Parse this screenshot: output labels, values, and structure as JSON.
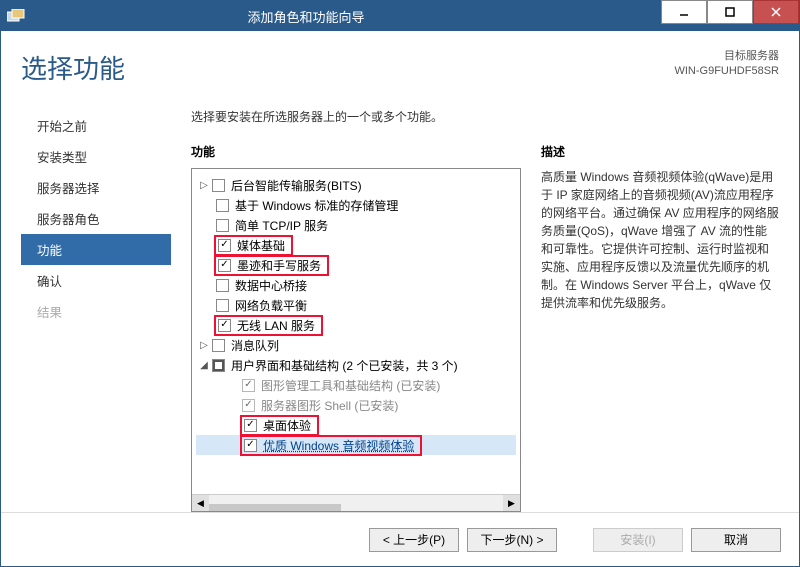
{
  "window": {
    "title": "添加角色和功能向导"
  },
  "header": {
    "page_title": "选择功能",
    "target_label": "目标服务器",
    "target_value": "WIN-G9FUHDF58SR"
  },
  "sidebar": {
    "items": [
      {
        "label": "开始之前"
      },
      {
        "label": "安装类型"
      },
      {
        "label": "服务器选择"
      },
      {
        "label": "服务器角色"
      },
      {
        "label": "功能"
      },
      {
        "label": "确认"
      },
      {
        "label": "结果"
      }
    ]
  },
  "main": {
    "instruction": "选择要安装在所选服务器上的一个或多个功能。",
    "features_label": "功能",
    "tree": [
      {
        "label": "后台智能传输服务(BITS)",
        "exp": "▷",
        "chk": "off",
        "lvl": 0
      },
      {
        "label": "基于 Windows 标准的存储管理",
        "chk": "off",
        "lvl": 1
      },
      {
        "label": "简单 TCP/IP 服务",
        "chk": "off",
        "lvl": 1
      },
      {
        "label": "媒体基础",
        "chk": "on",
        "lvl": 1,
        "hl": true
      },
      {
        "label": "墨迹和手写服务",
        "chk": "on",
        "lvl": 1,
        "hl": true
      },
      {
        "label": "数据中心桥接",
        "chk": "off",
        "lvl": 1
      },
      {
        "label": "网络负载平衡",
        "chk": "off",
        "lvl": 1
      },
      {
        "label": "无线 LAN 服务",
        "chk": "on",
        "lvl": 1,
        "hl": true
      },
      {
        "label": "消息队列",
        "exp": "▷",
        "chk": "off",
        "lvl": 0
      },
      {
        "label": "用户界面和基础结构 (2 个已安装，共 3 个)",
        "exp": "◢",
        "chk": "mixed",
        "lvl": 0
      },
      {
        "label": "图形管理工具和基础结构 (已安装)",
        "chk": "on",
        "lvl": 2,
        "disabled": true
      },
      {
        "label": "服务器图形 Shell (已安装)",
        "chk": "on",
        "lvl": 2,
        "disabled": true
      },
      {
        "label": "桌面体验",
        "chk": "on",
        "lvl": 2,
        "hl": true
      },
      {
        "label": "优质 Windows 音频视频体验",
        "chk": "on",
        "lvl": 2,
        "hl": true,
        "selected": true
      }
    ]
  },
  "description": {
    "label": "描述",
    "text": "高质量 Windows 音频视频体验(qWave)是用于 IP 家庭网络上的音频视频(AV)流应用程序的网络平台。通过确保 AV 应用程序的网络服务质量(QoS)，qWave 增强了 AV 流的性能和可靠性。它提供许可控制、运行时监视和实施、应用程序反馈以及流量优先顺序的机制。在 Windows Server 平台上，qWave 仅提供流率和优先级服务。"
  },
  "footer": {
    "prev": "< 上一步(P)",
    "next": "下一步(N) >",
    "install": "安装(I)",
    "cancel": "取消"
  }
}
